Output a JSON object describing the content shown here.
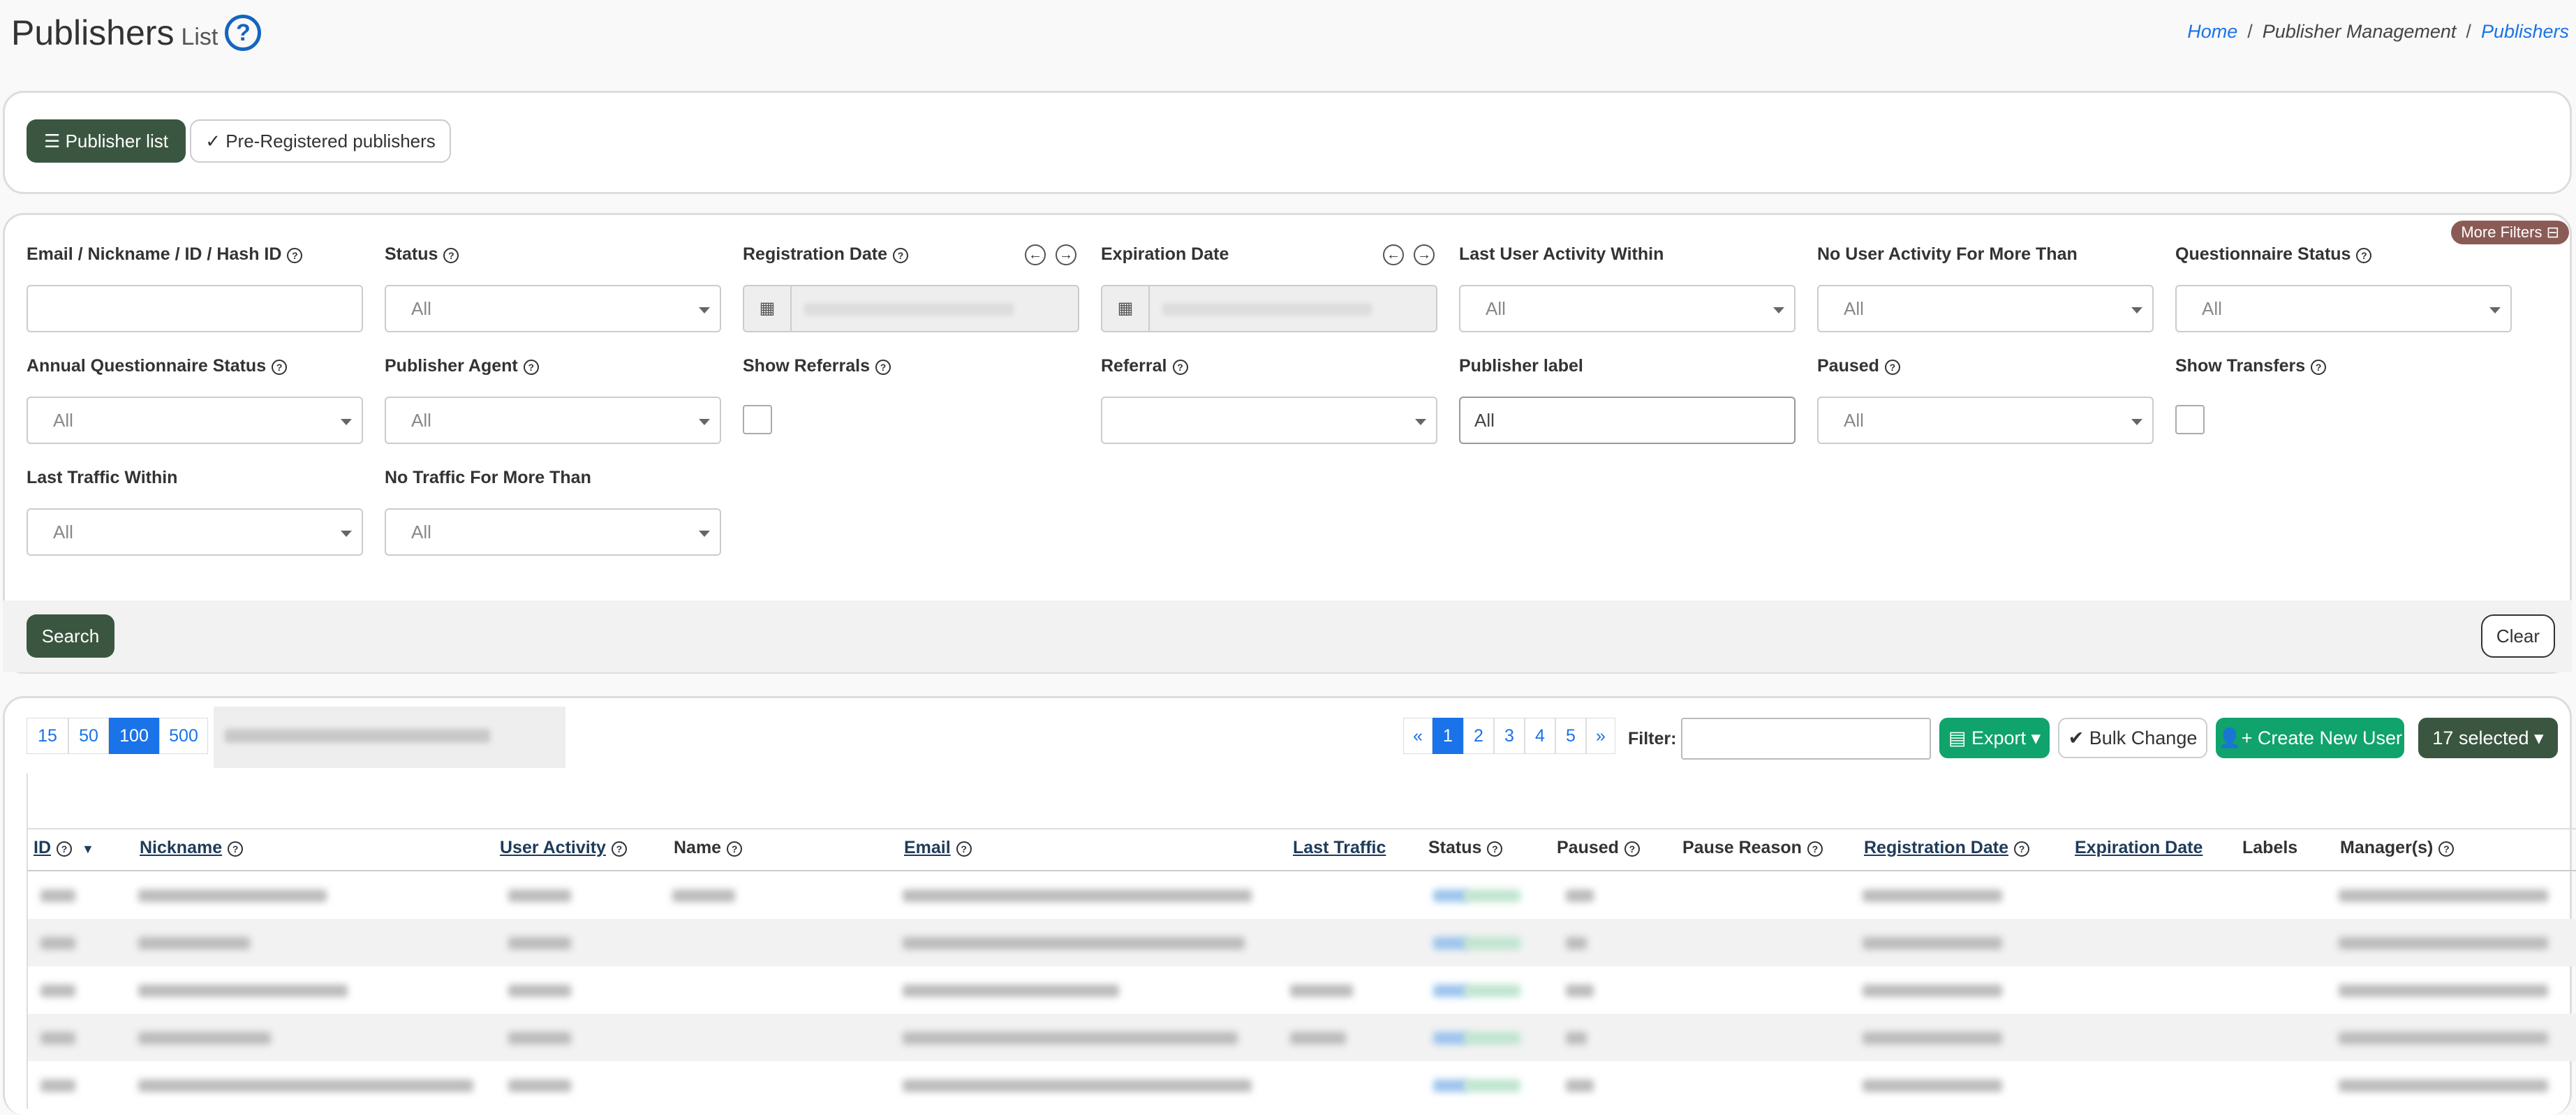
{
  "header": {
    "title": "Publishers",
    "subtitle": "List",
    "breadcrumb": {
      "home": "Home",
      "section": "Publisher Management",
      "current": "Publishers"
    }
  },
  "tabs": {
    "publisher_list": "Publisher list",
    "pre_registered": "Pre-Registered publishers"
  },
  "filters": {
    "more_filters": "More Filters",
    "email_label": "Email / Nickname / ID / Hash ID",
    "status_label": "Status",
    "registration_date_label": "Registration Date",
    "expiration_date_label": "Expiration Date",
    "last_user_activity_label": "Last User Activity Within",
    "no_user_activity_label": "No User Activity For More Than",
    "questionnaire_status_label": "Questionnaire Status",
    "annual_questionnaire_label": "Annual Questionnaire Status",
    "publisher_agent_label": "Publisher Agent",
    "show_referrals_label": "Show Referrals",
    "referral_label": "Referral",
    "publisher_label_label": "Publisher label",
    "paused_label": "Paused",
    "show_transfers_label": "Show Transfers",
    "last_traffic_label": "Last Traffic Within",
    "no_traffic_label": "No Traffic For More Than",
    "all": "All",
    "publisher_label_value": "All",
    "search": "Search",
    "clear": "Clear"
  },
  "table_controls": {
    "page_sizes": [
      "15",
      "50",
      "100",
      "500"
    ],
    "active_page_size": "100",
    "pages": [
      "«",
      "1",
      "2",
      "3",
      "4",
      "5",
      "»"
    ],
    "active_page": "1",
    "filter_label": "Filter:",
    "export": "Export",
    "bulk_change": "Bulk Change",
    "create_new_user": "Create New User",
    "selected": "17 selected"
  },
  "columns": [
    "ID",
    "Nickname",
    "User Activity",
    "Name",
    "Email",
    "Last Traffic",
    "Status",
    "Paused",
    "Pause Reason",
    "Registration Date",
    "Expiration Date",
    "Labels",
    "Manager(s)"
  ],
  "colors": {
    "dark_green": "#3b5640",
    "green": "#10a36c",
    "blue": "#1a73e8",
    "more_filters": "#8a5b55"
  }
}
